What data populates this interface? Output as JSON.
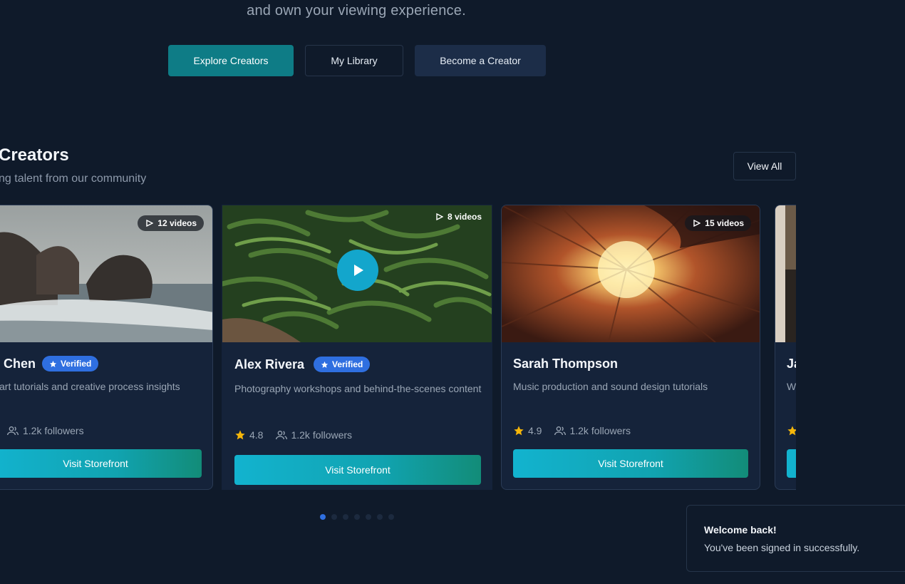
{
  "hero": {
    "subtitle": "and own your viewing experience.",
    "buttons": {
      "explore": "Explore Creators",
      "library": "My Library",
      "become": "Become a Creator"
    }
  },
  "section": {
    "title": "Creators",
    "subtitle": "ng talent from our community",
    "view_all": "View All"
  },
  "cards": [
    {
      "name": "Chen",
      "verified": "Verified",
      "videos": "12 videos",
      "desc": "art tutorials and creative process insights",
      "followers": "1.2k followers",
      "visit": "Visit Storefront"
    },
    {
      "name": "Alex Rivera",
      "verified": "Verified",
      "videos": "8 videos",
      "desc": "Photography workshops and behind-the-scenes content",
      "rating": "4.8",
      "followers": "1.2k followers",
      "visit": "Visit Storefront"
    },
    {
      "name": "Sarah Thompson",
      "videos": "15 videos",
      "desc": "Music production and sound design tutorials",
      "rating": "4.9",
      "followers": "1.2k followers",
      "visit": "Visit Storefront"
    },
    {
      "name": "Ja",
      "desc": "W"
    }
  ],
  "pagination": {
    "total": 7,
    "current": 1
  },
  "toast": {
    "title": "Welcome back!",
    "message": "You've been signed in successfully."
  },
  "colors": {
    "background": "#0f1a2a",
    "card": "#15233a",
    "accent_teal": "#0e7c86",
    "verified_blue": "#2f6fe0",
    "star": "#f5b60a"
  }
}
